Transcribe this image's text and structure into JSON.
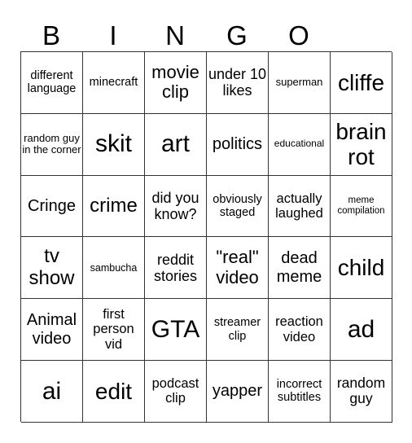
{
  "header": {
    "letters": [
      "B",
      "I",
      "N",
      "G",
      "O"
    ]
  },
  "grid": {
    "rows": [
      [
        "different language",
        "minecraft",
        "movie clip",
        "under 10 likes",
        "superman",
        "cliffe"
      ],
      [
        "random guy in the corner",
        "skit",
        "art",
        "politics",
        "educational",
        "brain rot"
      ],
      [
        "Cringe",
        "crime",
        "did you know?",
        "obviously staged",
        "actually laughed",
        "meme compilation"
      ],
      [
        "tv show",
        "sambucha",
        "reddit stories",
        "\"real\" video",
        "dead meme",
        "child"
      ],
      [
        "Animal video",
        "first person vid",
        "GTA",
        "streamer clip",
        "reaction video",
        "ad"
      ],
      [
        "ai",
        "edit",
        "podcast clip",
        "yapper",
        "incorrect subtitles",
        "random guy"
      ]
    ]
  },
  "colors": {
    "border": "#333333",
    "text": "#000000",
    "background": "#ffffff"
  }
}
